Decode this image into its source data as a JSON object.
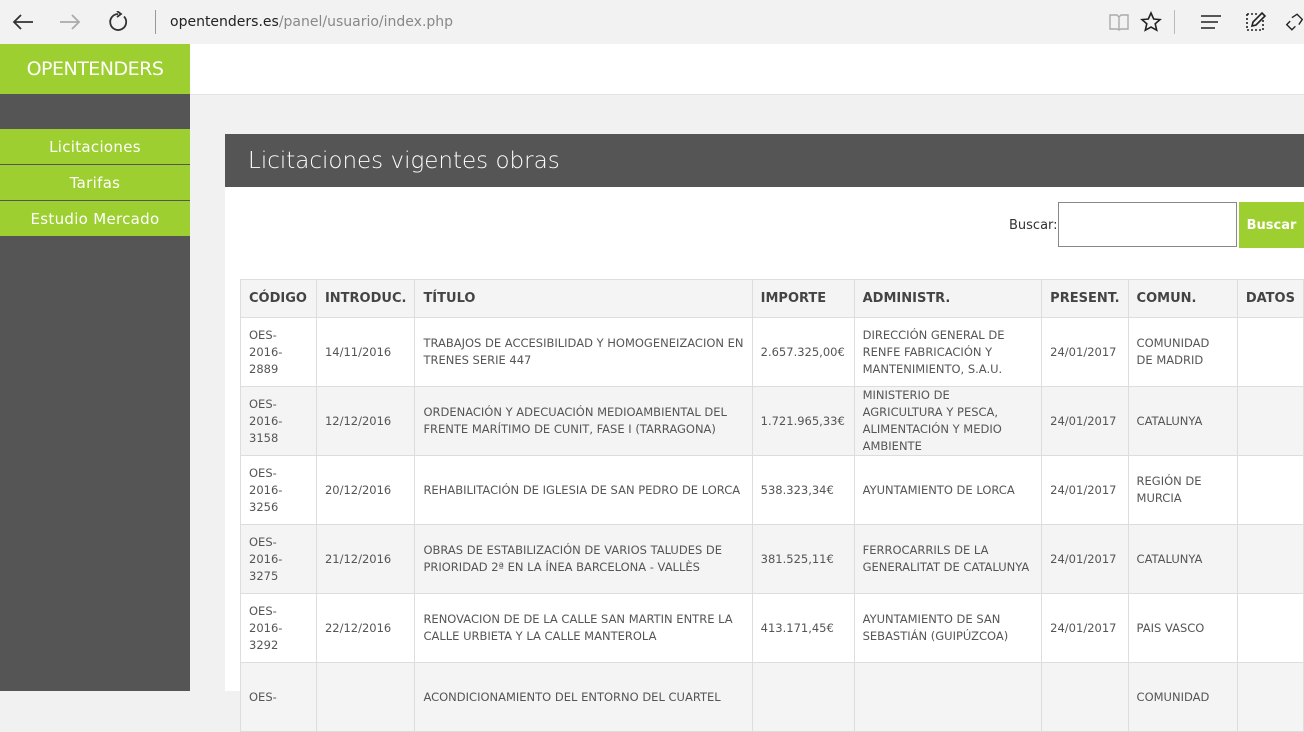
{
  "browser": {
    "url_domain": "opentenders.es",
    "url_path": "/panel/usuario/index.php"
  },
  "sidebar": {
    "logo": "OPENTENDERS",
    "items": [
      {
        "label": "Licitaciones"
      },
      {
        "label": "Tarifas"
      },
      {
        "label": "Estudio Mercado"
      }
    ]
  },
  "panel": {
    "title": "Licitaciones vigentes obras",
    "search_label": "Buscar:",
    "search_button": "Buscar"
  },
  "table": {
    "headers": [
      "CÓDIGO",
      "INTRODUC.",
      "TÍTULO",
      "IMPORTE",
      "ADMINISTR.",
      "PRESENT.",
      "COMUN.",
      "DATOS"
    ],
    "rows": [
      [
        "OES-\n2016-\n2889",
        "14/11/2016",
        "TRABAJOS DE ACCESIBILIDAD Y HOMOGENEIZACION EN TRENES SERIE 447",
        "2.657.325,00€",
        "DIRECCIÓN GENERAL DE RENFE FABRICACIÓN Y MANTENIMIENTO, S.A.U.",
        "24/01/2017",
        "COMUNIDAD DE MADRID",
        ""
      ],
      [
        "OES-\n2016-\n3158",
        "12/12/2016",
        "ORDENACIÓN Y ADECUACIÓN MEDIOAMBIENTAL DEL FRENTE MARÍTIMO DE CUNIT, FASE I (TARRAGONA)",
        "1.721.965,33€",
        "MINISTERIO DE AGRICULTURA Y PESCA, ALIMENTACIÓN Y MEDIO AMBIENTE",
        "24/01/2017",
        "CATALUNYA",
        ""
      ],
      [
        "OES-\n2016-\n3256",
        "20/12/2016",
        "REHABILITACIÓN DE IGLESIA DE SAN PEDRO DE LORCA",
        "538.323,34€",
        "AYUNTAMIENTO DE LORCA",
        "24/01/2017",
        "REGIÓN DE MURCIA",
        ""
      ],
      [
        "OES-\n2016-\n3275",
        "21/12/2016",
        "OBRAS DE ESTABILIZACIÓN DE VARIOS TALUDES DE PRIORIDAD 2ª EN LA ÍNEA BARCELONA - VALLÈS",
        "381.525,11€",
        "FERROCARRILS DE LA GENERALITAT DE CATALUNYA",
        "24/01/2017",
        "CATALUNYA",
        ""
      ],
      [
        "OES-\n2016-\n3292",
        "22/12/2016",
        "RENOVACION DE DE LA CALLE SAN MARTIN ENTRE LA CALLE URBIETA Y LA CALLE MANTEROLA",
        "413.171,45€",
        "AYUNTAMIENTO DE SAN SEBASTIÁN (GUIPÚZCOA)",
        "24/01/2017",
        "PAIS VASCO",
        ""
      ],
      [
        "OES-",
        "",
        "ACONDICIONAMIENTO DEL ENTORNO DEL CUARTEL",
        "",
        "",
        "",
        "COMUNIDAD",
        ""
      ]
    ]
  }
}
